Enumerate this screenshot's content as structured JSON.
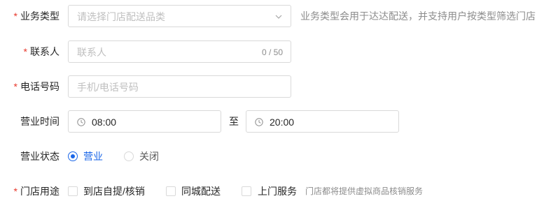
{
  "business_type": {
    "label": "业务类型",
    "placeholder": "请选择门店配送品类",
    "hint": "业务类型会用于达达配送，并支持用户按类型筛选门店"
  },
  "contact": {
    "label": "联系人",
    "placeholder": "联系人",
    "counter": "0 / 50"
  },
  "phone": {
    "label": "电话号码",
    "placeholder": "手机/电话号码"
  },
  "hours": {
    "label": "营业时间",
    "start": "08:00",
    "separator": "至",
    "end": "20:00"
  },
  "status": {
    "label": "营业状态",
    "options": [
      {
        "label": "营业",
        "selected": true
      },
      {
        "label": "关闭",
        "selected": false
      }
    ]
  },
  "usage": {
    "label": "门店用途",
    "options": [
      {
        "label": "到店自提/核销",
        "checked": false
      },
      {
        "label": "同城配送",
        "checked": false
      },
      {
        "label": "上门服务",
        "checked": false
      }
    ],
    "hint": "门店都将提供虚拟商品核销服务"
  },
  "required_mark": "*",
  "colors": {
    "accent": "#1a66e8",
    "required": "#e8382c",
    "border": "#d9d9d9",
    "placeholder": "#bfbfbf"
  },
  "icons": {
    "select_arrow": "chevron-down-icon",
    "time": "clock-icon"
  }
}
